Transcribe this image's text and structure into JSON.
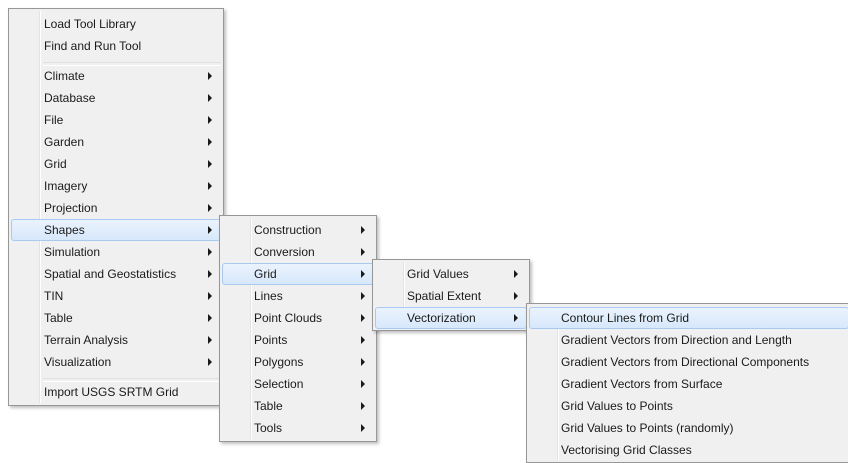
{
  "main_menu": {
    "items": [
      {
        "label": "Load Tool Library",
        "submenu": false
      },
      {
        "label": "Find and Run Tool",
        "submenu": false
      },
      {
        "label": "Climate",
        "submenu": true
      },
      {
        "label": "Database",
        "submenu": true
      },
      {
        "label": "File",
        "submenu": true
      },
      {
        "label": "Garden",
        "submenu": true
      },
      {
        "label": "Grid",
        "submenu": true
      },
      {
        "label": "Imagery",
        "submenu": true
      },
      {
        "label": "Projection",
        "submenu": true
      },
      {
        "label": "Shapes",
        "submenu": true,
        "highlighted": true
      },
      {
        "label": "Simulation",
        "submenu": true
      },
      {
        "label": "Spatial and Geostatistics",
        "submenu": true
      },
      {
        "label": "TIN",
        "submenu": true
      },
      {
        "label": "Table",
        "submenu": true
      },
      {
        "label": "Terrain Analysis",
        "submenu": true
      },
      {
        "label": "Visualization",
        "submenu": true
      },
      {
        "label": "Import USGS SRTM Grid",
        "submenu": false
      }
    ]
  },
  "shapes_menu": {
    "items": [
      {
        "label": "Construction",
        "submenu": true
      },
      {
        "label": "Conversion",
        "submenu": true
      },
      {
        "label": "Grid",
        "submenu": true,
        "highlighted": true
      },
      {
        "label": "Lines",
        "submenu": true
      },
      {
        "label": "Point Clouds",
        "submenu": true
      },
      {
        "label": "Points",
        "submenu": true
      },
      {
        "label": "Polygons",
        "submenu": true
      },
      {
        "label": "Selection",
        "submenu": true
      },
      {
        "label": "Table",
        "submenu": true
      },
      {
        "label": "Tools",
        "submenu": true
      }
    ]
  },
  "grid_menu": {
    "items": [
      {
        "label": "Grid Values",
        "submenu": true
      },
      {
        "label": "Spatial Extent",
        "submenu": true
      },
      {
        "label": "Vectorization",
        "submenu": true,
        "highlighted": true
      }
    ]
  },
  "vectorization_menu": {
    "items": [
      {
        "label": "Contour Lines from Grid",
        "highlighted": true
      },
      {
        "label": "Gradient Vectors from Direction and Length"
      },
      {
        "label": "Gradient Vectors from Directional Components"
      },
      {
        "label": "Gradient Vectors from Surface"
      },
      {
        "label": "Grid Values to Points"
      },
      {
        "label": "Grid Values to Points (randomly)"
      },
      {
        "label": "Vectorising Grid Classes"
      }
    ]
  },
  "colors": {
    "menu_background": "#f0f0f0",
    "menu_border": "#979797",
    "highlight_fill": "#d7e8fb",
    "highlight_border": "#a8caf0"
  }
}
